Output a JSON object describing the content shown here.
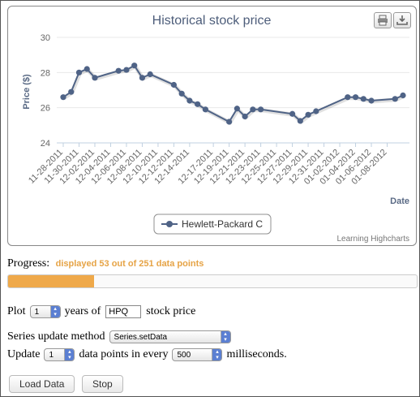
{
  "chart_data": {
    "type": "line",
    "title": "Historical stock price",
    "xlabel": "Date",
    "ylabel": "Price ($)",
    "ylim": [
      24,
      30
    ],
    "yticks": [
      24,
      26,
      28,
      30
    ],
    "legend_position": "bottom-center",
    "grid": true,
    "credit": "Learning Highcharts",
    "x_tick_labels": [
      "11-28-2011",
      "11-30-2011",
      "12-02-2011",
      "12-04-2011",
      "12-06-2011",
      "12-08-2011",
      "12-10-2011",
      "12-12-2011",
      "12-14-2011",
      "12-17-2011",
      "12-19-2011",
      "12-21-2011",
      "12-23-2011",
      "12-25-2011",
      "12-27-2011",
      "12-29-2011",
      "12-31-2011",
      "01-02-2012",
      "01-04-2012",
      "01-06-2012",
      "01-08-2012"
    ],
    "series": [
      {
        "name": "Hewlett-Packard C",
        "color": "#4f6386",
        "x": [
          "2011-11-28",
          "2011-11-29",
          "2011-11-30",
          "2011-12-01",
          "2011-12-02",
          "2011-12-05",
          "2011-12-06",
          "2011-12-07",
          "2011-12-08",
          "2011-12-09",
          "2011-12-12",
          "2011-12-13",
          "2011-12-14",
          "2011-12-15",
          "2011-12-16",
          "2011-12-19",
          "2011-12-20",
          "2011-12-21",
          "2011-12-22",
          "2011-12-23",
          "2011-12-27",
          "2011-12-28",
          "2011-12-29",
          "2011-12-30",
          "2012-01-03",
          "2012-01-04",
          "2012-01-05",
          "2012-01-06",
          "2012-01-09",
          "2012-01-10"
        ],
        "y": [
          26.6,
          26.9,
          28.0,
          28.2,
          27.7,
          28.1,
          28.15,
          28.4,
          27.7,
          27.9,
          27.3,
          26.8,
          26.4,
          26.2,
          25.9,
          25.2,
          25.95,
          25.5,
          25.9,
          25.9,
          25.65,
          25.25,
          25.6,
          25.8,
          26.6,
          26.6,
          26.5,
          26.4,
          26.5,
          26.7
        ]
      }
    ]
  },
  "progress": {
    "label": "Progress:",
    "status": "displayed 53 out of 251 data points",
    "fraction": 0.211
  },
  "controls": {
    "plot_prefix": "Plot",
    "years_value": "1",
    "years_label": "years of",
    "symbol_value": "HPQ",
    "symbol_suffix": "stock price",
    "method_label": "Series update method",
    "method_value": "Series.setData",
    "update_label": "Update",
    "update_points_value": "1",
    "points_label": "data points in every",
    "interval_value": "500",
    "interval_label": "milliseconds."
  },
  "buttons": {
    "load": "Load Data",
    "stop": "Stop"
  },
  "icons": {
    "print": "print-icon",
    "export": "download-icon"
  }
}
